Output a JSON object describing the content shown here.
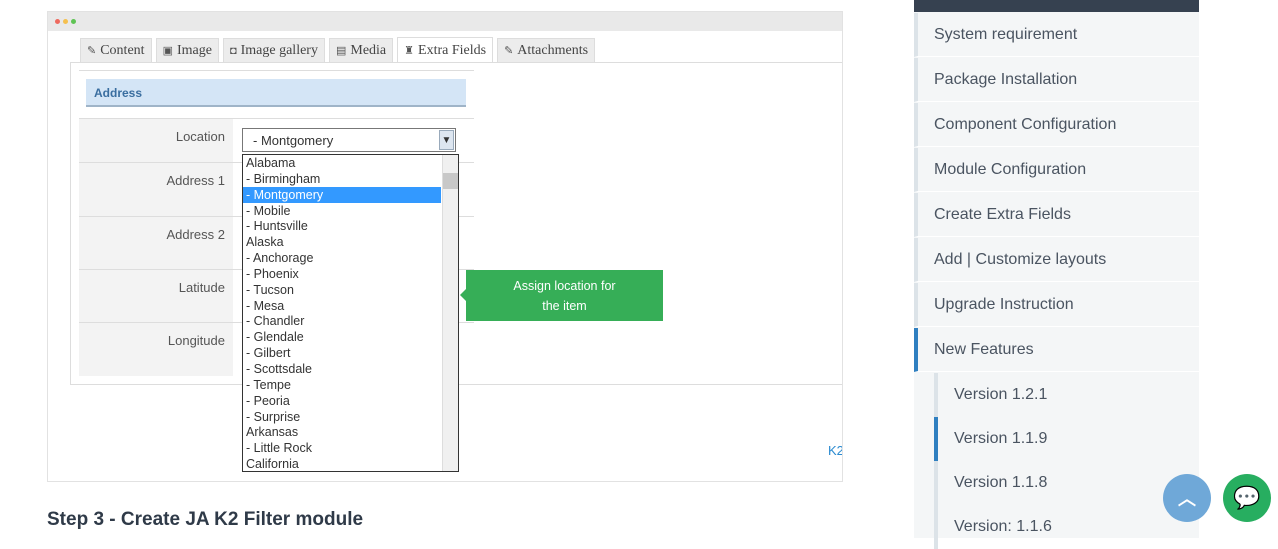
{
  "tabs": [
    {
      "label": "Content",
      "icon": "edit-icon"
    },
    {
      "label": "Image",
      "icon": "image-icon"
    },
    {
      "label": "Image gallery",
      "icon": "camera-icon"
    },
    {
      "label": "Media",
      "icon": "film-icon"
    },
    {
      "label": "Extra Fields",
      "icon": "puzzle-icon"
    },
    {
      "label": "Attachments",
      "icon": "paperclip-icon"
    }
  ],
  "section_title": "Address",
  "fields": [
    "Location",
    "Address 1",
    "Address 2",
    "Latitude",
    "Longitude"
  ],
  "select_value": "- Montgomery",
  "options": [
    "Alabama",
    "- Birmingham",
    "- Montgomery",
    "- Mobile",
    "- Huntsville",
    "Alaska",
    "- Anchorage",
    "- Phoenix",
    "- Tucson",
    "- Mesa",
    "- Chandler",
    "- Glendale",
    "- Gilbert",
    "- Scottsdale",
    "- Tempe",
    "- Peoria",
    "- Surprise",
    "Arkansas",
    "- Little Rock",
    "California"
  ],
  "tooltip_line1": "Assign location for",
  "tooltip_line2": "the item",
  "k2_link": "K2",
  "step_heading": "Step 3 - Create JA K2 Filter module",
  "sidebar": {
    "items": [
      "System requirement",
      "Package Installation",
      "Component Configuration",
      "Module Configuration",
      "Create Extra Fields",
      "Add | Customize layouts",
      "Upgrade Instruction",
      "New Features"
    ],
    "sub_items": [
      "Version 1.2.1",
      "Version 1.1.9",
      "Version 1.1.8",
      "Version: 1.1.6"
    ]
  },
  "colors": {
    "accent": "#2f7fc0",
    "tooltip": "#36ae57",
    "chat": "#27ae60",
    "scroll_top": "#6fa8d8"
  }
}
